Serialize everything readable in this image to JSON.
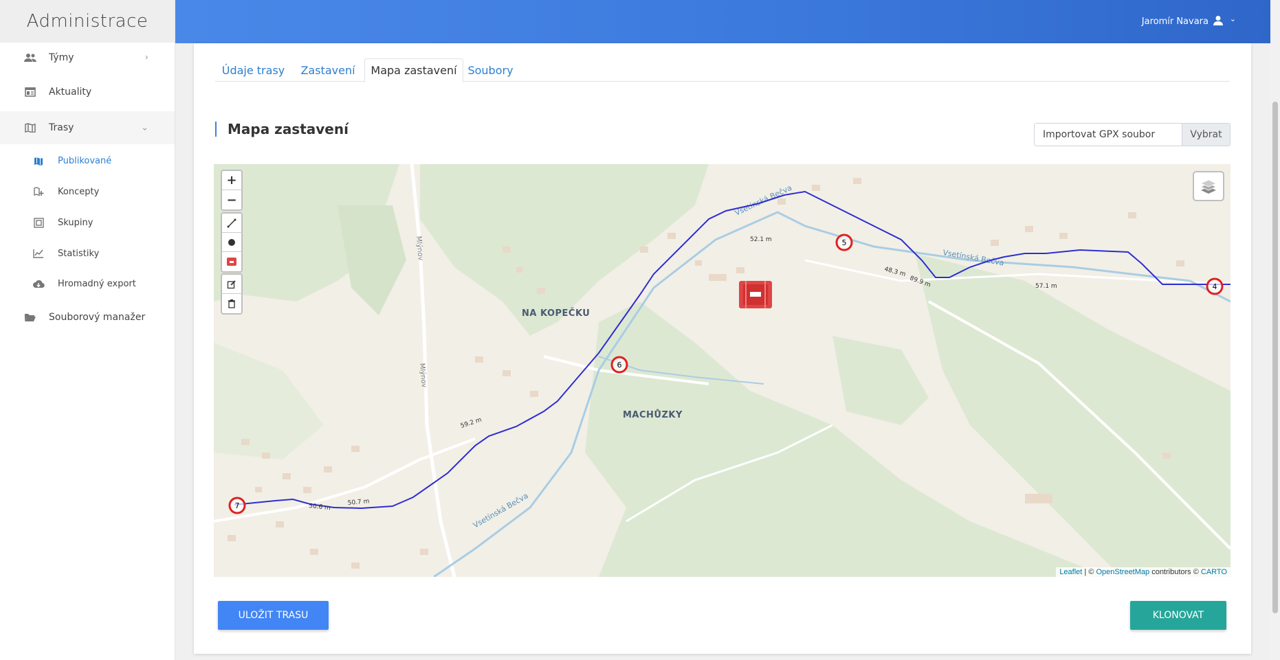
{
  "brand": "Administrace",
  "user": {
    "name": "Jaromír Navara"
  },
  "sidebar": {
    "items": [
      {
        "label": "Týmy"
      },
      {
        "label": "Aktuality"
      },
      {
        "label": "Trasy"
      },
      {
        "label": "Souborový manažer"
      }
    ],
    "sub_items": [
      {
        "label": "Publikované"
      },
      {
        "label": "Koncepty"
      },
      {
        "label": "Skupiny"
      },
      {
        "label": "Statistiky"
      },
      {
        "label": "Hromadný export"
      }
    ]
  },
  "tabs": [
    {
      "label": "Údaje trasy"
    },
    {
      "label": "Zastavení"
    },
    {
      "label": "Mapa zastavení",
      "active": true
    },
    {
      "label": "Soubory"
    }
  ],
  "section": {
    "title": "Mapa zastavení"
  },
  "gpx": {
    "label": "Importovat GPX soubor",
    "button": "Vybrat"
  },
  "map": {
    "labels": {
      "na_kopecku": "NA KOPEČKU",
      "machuzky": "MACHŮZKY"
    },
    "street_labels": [
      "Vsetínská Bečva",
      "Mlýnov"
    ],
    "markers": [
      "4",
      "5",
      "6",
      "7"
    ],
    "distances": [
      "52.1 m",
      "48.3 m",
      "89.9 m",
      "57.1 m",
      "59.2 m",
      "50.6 m",
      "50.7 m"
    ],
    "attribution": {
      "leaflet": "Leaflet",
      "sep": " | © ",
      "osm": "OpenStreetMap",
      "mid": " contributors © ",
      "carto": "CARTO"
    }
  },
  "buttons": {
    "save": "ULOŽIT TRASU",
    "clone": "KLONOVAT"
  },
  "colors": {
    "primary": "#4285f4",
    "success": "#26a69a",
    "route": "#2d2dd1",
    "marker": "#e02020"
  }
}
